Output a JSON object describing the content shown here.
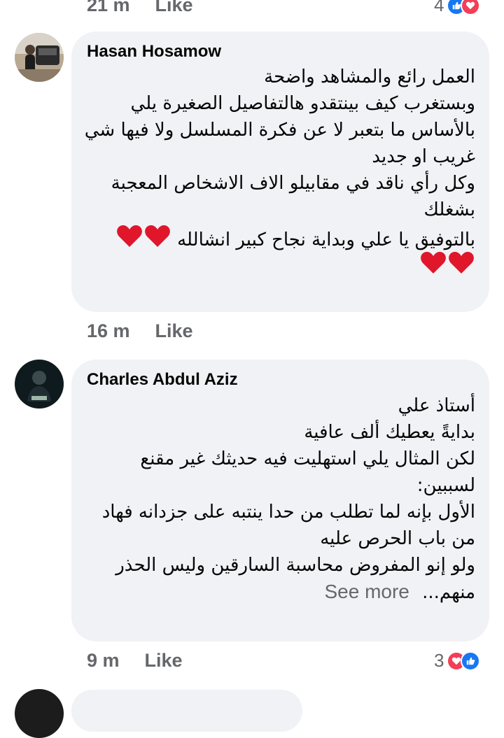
{
  "top": {
    "time": "21 m",
    "like_label": "Like",
    "reaction_count": "4"
  },
  "comments": [
    {
      "author": "Hasan Hosamow",
      "lines": [
        "العمل رائع والمشاهد واضحة",
        "وبستغرب كيف بينتقدو هالتفاصيل الصغيرة يلي",
        "بالأساس ما بتعبر لا عن فكرة المسلسل ولا فيها شي",
        "غريب او جديد",
        "وكل رأي ناقد في مقابيلو الاف الاشخاص المعجبة",
        "بشغلك",
        "بالتوفيق يا علي وبداية نجاح كبير انشالله"
      ],
      "time": "16 m",
      "like_label": "Like"
    },
    {
      "author": "Charles Abdul Aziz",
      "lines": [
        "أستاذ علي",
        "بدايةً يعطيك ألف عافية",
        "لكن المثال يلي استهليت فيه حديثك غير مقنع",
        "لسببين:",
        "الأول بإنه لما تطلب من حدا ينتبه على جزدانه فهاد",
        "من باب الحرص عليه",
        "ولو إنو المفروض محاسبة السارقين وليس الحذر",
        "منهم..."
      ],
      "see_more": "See more",
      "time": "9 m",
      "like_label": "Like",
      "reaction_count": "3"
    }
  ],
  "colors": {
    "bubble": "#f0f2f5",
    "meta": "#65676b",
    "like_blue": "#1877f2",
    "love_red": "#f33e58",
    "heart": "#e0162b"
  }
}
